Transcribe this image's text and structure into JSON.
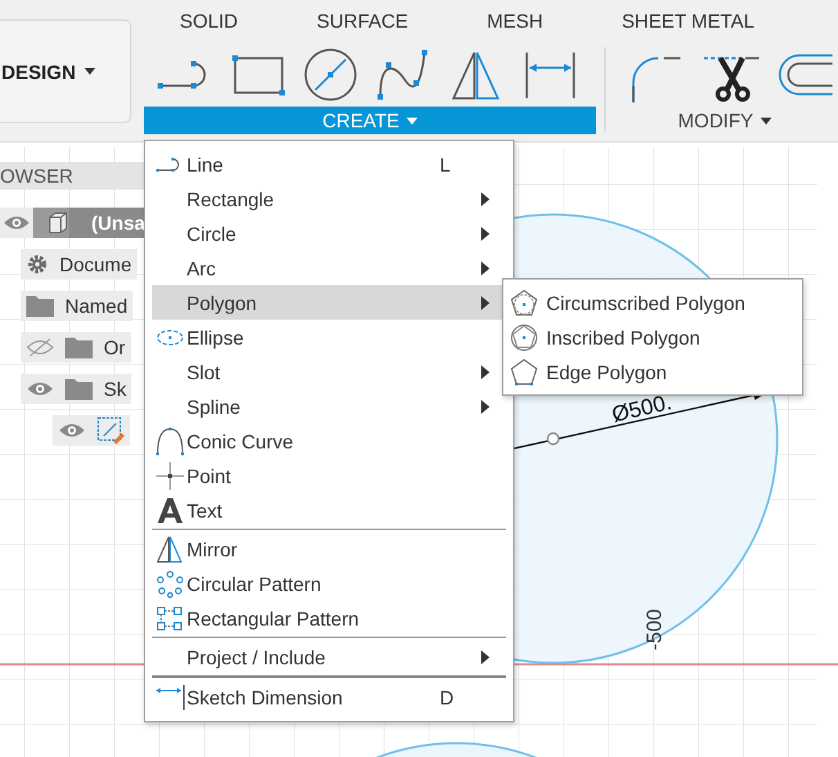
{
  "workspace_button": {
    "label": "DESIGN"
  },
  "tabs": [
    {
      "label": "SOLID"
    },
    {
      "label": "SURFACE"
    },
    {
      "label": "MESH"
    },
    {
      "label": "SHEET METAL"
    }
  ],
  "toolbar_groups": [
    {
      "label": "CREATE",
      "open": true,
      "tools": [
        {
          "kind": "line"
        },
        {
          "kind": "rectangle"
        },
        {
          "kind": "circle"
        },
        {
          "kind": "spline"
        },
        {
          "kind": "mirror"
        },
        {
          "kind": "dimension"
        }
      ]
    },
    {
      "label": "MODIFY",
      "open": false,
      "tools": [
        {
          "kind": "fillet"
        },
        {
          "kind": "trim"
        },
        {
          "kind": "offset"
        }
      ]
    }
  ],
  "browser": {
    "title": "OWSER",
    "items": [
      {
        "label": "(Unsa",
        "kind": "component",
        "visible": true,
        "children": [
          {
            "label": "Docume",
            "kind": "settings"
          },
          {
            "label": "Named",
            "kind": "folder"
          },
          {
            "label": "Or",
            "kind": "folder",
            "visible": false
          },
          {
            "label": "Sk",
            "kind": "folder",
            "visible": true,
            "children": [
              {
                "kind": "sketch",
                "visible": true
              }
            ]
          }
        ]
      }
    ]
  },
  "canvas": {
    "dimension_label": "Ø500.",
    "axis_label": "-500"
  },
  "menu": {
    "sections": [
      {
        "items": [
          {
            "label": "Line",
            "kind": "line",
            "shortcut": "L",
            "submenu": false,
            "selected": false
          },
          {
            "label": "Rectangle",
            "kind": "plain",
            "submenu": true,
            "selected": false
          },
          {
            "label": "Circle",
            "kind": "plain",
            "submenu": true,
            "selected": false
          },
          {
            "label": "Arc",
            "kind": "plain",
            "submenu": true,
            "selected": false
          },
          {
            "label": "Polygon",
            "kind": "plain",
            "submenu": true,
            "selected": true
          },
          {
            "label": "Ellipse",
            "kind": "ellipse",
            "submenu": false,
            "selected": false
          },
          {
            "label": "Slot",
            "kind": "plain",
            "submenu": true,
            "selected": false
          },
          {
            "label": "Spline",
            "kind": "plain",
            "submenu": true,
            "selected": false
          },
          {
            "label": "Conic Curve",
            "kind": "conic",
            "submenu": false,
            "selected": false
          },
          {
            "label": "Point",
            "kind": "point",
            "submenu": false,
            "selected": false
          },
          {
            "label": "Text",
            "kind": "text",
            "submenu": false,
            "selected": false
          }
        ]
      },
      {
        "items": [
          {
            "label": "Mirror",
            "kind": "mirror",
            "submenu": false,
            "selected": false
          },
          {
            "label": "Circular Pattern",
            "kind": "circular-pattern",
            "submenu": false,
            "selected": false
          },
          {
            "label": "Rectangular Pattern",
            "kind": "rectangular-pattern",
            "submenu": false,
            "selected": false
          }
        ]
      },
      {
        "items": [
          {
            "label": "Project / Include",
            "kind": "plain",
            "submenu": true,
            "selected": false
          }
        ]
      },
      {
        "items": [
          {
            "label": "Sketch Dimension",
            "kind": "dimension",
            "shortcut": "D",
            "submenu": false,
            "selected": false
          }
        ]
      }
    ]
  },
  "submenu": {
    "items": [
      {
        "label": "Circumscribed Polygon",
        "kind": "circumscribed"
      },
      {
        "label": "Inscribed Polygon",
        "kind": "inscribed"
      },
      {
        "label": "Edge Polygon",
        "kind": "edge"
      }
    ]
  }
}
